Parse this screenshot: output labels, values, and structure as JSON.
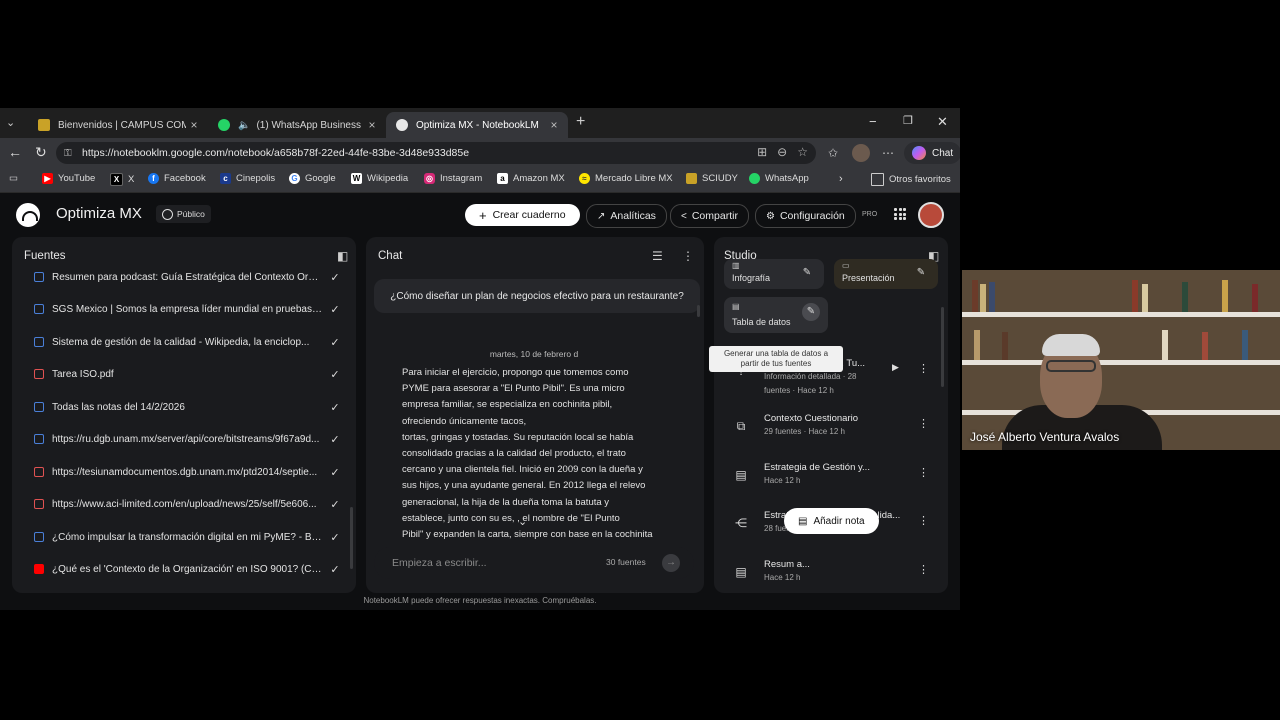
{
  "browser": {
    "tabs": [
      {
        "label": "Bienvenidos | CAMPUS COMALCA",
        "color": "#c9a227"
      },
      {
        "label": "(1) WhatsApp Business",
        "color": "#25d366"
      },
      {
        "label": "Optimiza MX - NotebookLM",
        "color": "#e8e8e8"
      }
    ],
    "url": "https://notebooklm.google.com/notebook/a658b78f-22ed-44fe-83be-3d48e933d85e",
    "chat_button": "Chat",
    "bookmarks": [
      {
        "label": "YouTube",
        "icon": "youtube-icon",
        "color": "#ff0000"
      },
      {
        "label": "X",
        "icon": "x-icon",
        "color": "#000000"
      },
      {
        "label": "Facebook",
        "icon": "facebook-icon",
        "color": "#1877f2"
      },
      {
        "label": "Cinepolis",
        "icon": "cinepolis-icon",
        "color": "#1b3a8c"
      },
      {
        "label": "Google",
        "icon": "google-icon",
        "color": "#4285f4"
      },
      {
        "label": "Wikipedia",
        "icon": "wikipedia-icon",
        "color": "#ffffff"
      },
      {
        "label": "Instagram",
        "icon": "instagram-icon",
        "color": "#d62976"
      },
      {
        "label": "Amazon MX",
        "icon": "amazon-icon",
        "color": "#ffffff"
      },
      {
        "label": "Mercado Libre MX",
        "icon": "mercadolibre-icon",
        "color": "#ffe600"
      },
      {
        "label": "SCIUDY",
        "icon": "sciudy-icon",
        "color": "#c9a227"
      },
      {
        "label": "WhatsApp",
        "icon": "whatsapp-icon",
        "color": "#25d366"
      }
    ],
    "other_favorites": "Otros favoritos"
  },
  "app": {
    "title": "Optimiza MX",
    "visibility": "Público",
    "create_notebook": "Crear cuaderno",
    "analytics": "Analíticas",
    "share": "Compartir",
    "settings": "Configuración",
    "plan": "PRO",
    "disclaimer": "NotebookLM puede ofrecer respuestas inexactas. Compruébalas."
  },
  "sources": {
    "title": "Fuentes",
    "items": [
      {
        "label": "Resumen para podcast: Guía Estratégica del Contexto Org...",
        "color": "#4a7fd8"
      },
      {
        "label": "SGS Mexico | Somos la empresa líder mundial en pruebas, ...",
        "color": "#4a7fd8"
      },
      {
        "label": "Sistema de gestión de la calidad - Wikipedia, la enciclop...",
        "color": "#4a7fd8"
      },
      {
        "label": "Tarea ISO.pdf",
        "color": "#e05252"
      },
      {
        "label": "Todas las notas del 14/2/2026",
        "color": "#4a7fd8"
      },
      {
        "label": "https://ru.dgb.unam.mx/server/api/core/bitstreams/9f67a9d...",
        "color": "#4a7fd8"
      },
      {
        "label": "https://tesiunamdocumentos.dgb.unam.mx/ptd2014/septie...",
        "color": "#e05252"
      },
      {
        "label": "https://www.aci-limited.com/en/upload/news/25/self/5e606...",
        "color": "#e05252"
      },
      {
        "label": "¿Cómo impulsar la transformación digital en mi PyME? - Bl...",
        "color": "#4a7fd8"
      },
      {
        "label": "¿Qué es el 'Contexto de la Organización' en ISO 9001? (Cl...",
        "color": "#ff0000"
      }
    ]
  },
  "chat": {
    "title": "Chat",
    "user_question": "¿Cómo diseñar un plan de negocios efectivo para un restaurante?",
    "date": "martes, 10 de febrero d",
    "response_lines": [
      "Para iniciar el ejercicio, propongo que tomemos como",
      "PYME para asesorar a \"El Punto Pibil\". Es una micro",
      "empresa familiar, se especializa en cochinita pibil,",
      "ofreciendo únicamente tacos,",
      "tortas, gringas y tostadas. Su reputación local se había",
      "consolidado gracias a la calidad del producto, el trato",
      "cercano y una clientela fiel.  Inició en 2009 con la dueña y",
      "sus hijos, y una ayudante general. En 2012 llega el relevo",
      "generacional, la hija de la dueña toma la batuta y",
      "establece, junto con su es,    , el nombre de \"El Punto",
      "Pibil\" y expanden la carta, siempre con base en la cochinita"
    ],
    "input_placeholder": "Empieza a escribir...",
    "source_count": "30 fuentes"
  },
  "studio": {
    "title": "Studio",
    "tiles": [
      {
        "label": "Infografía"
      },
      {
        "label": "Presentación"
      },
      {
        "label": "Tabla de datos"
      }
    ],
    "tooltip_line1": "Generar una tabla de datos a",
    "tooltip_line2": "partir de tus fuentes",
    "notes": [
      {
        "title": "... Tu...",
        "sub1": "Información detallada · 28",
        "sub2": "fuentes · Hace 12 h",
        "icon": "audio-icon"
      },
      {
        "title": "Contexto Cuestionario",
        "sub1": "29 fuentes · Hace 12 h",
        "icon": "flashcards-icon"
      },
      {
        "title": "Estrategia de Gestión y...",
        "sub1": "Hace 12 h",
        "icon": "note-icon"
      },
      {
        "title": "Estrategia de Gestión y Calida...",
        "sub1": "28 fuentes · Hace 12 h",
        "icon": "mindmap-icon"
      },
      {
        "title": "Resum                          a...",
        "sub1": "Hace 12 h",
        "icon": "note-icon"
      }
    ],
    "add_note": "Añadir nota"
  },
  "video": {
    "participant_name": "José Alberto Ventura Avalos"
  }
}
